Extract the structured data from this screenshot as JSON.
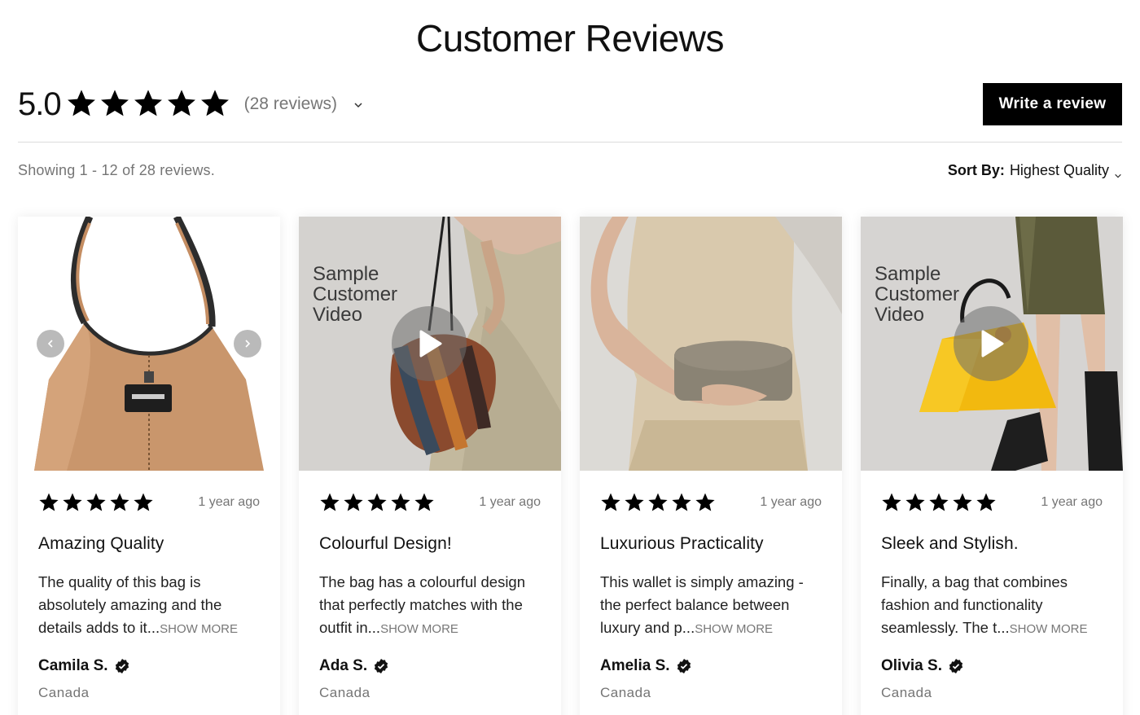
{
  "header": {
    "title": "Customer Reviews"
  },
  "summary": {
    "average": "5.0",
    "stars": 5,
    "count_label": "(28 reviews)",
    "write_review_label": "Write a review"
  },
  "listing": {
    "showing_text": "Showing 1 - 12 of 28 reviews.",
    "sort_label": "Sort By:",
    "sort_value": "Highest Quality"
  },
  "colors": {
    "accent": "#000000",
    "muted_text": "#757575",
    "divider": "#dcdcdc"
  },
  "reviews": [
    {
      "media_type": "image",
      "media_icon": "tan-hobo-bag-photo",
      "rating": 5,
      "time_ago": "1 year ago",
      "title": "Amazing Quality",
      "text": "The quality of this bag is absolutely amazing and the details adds to it...",
      "show_more": "SHOW MORE",
      "author": "Camila S.",
      "country": "Canada"
    },
    {
      "media_type": "video",
      "media_label": "Sample\nCustomer\nVideo",
      "media_icon": "striped-bucket-bag-photo",
      "rating": 5,
      "time_ago": "1 year ago",
      "title": "Colourful Design!",
      "text": "The bag has a colourful design that perfectly matches with the outfit in...",
      "show_more": "SHOW MORE",
      "author": "Ada S.",
      "country": "Canada"
    },
    {
      "media_type": "image",
      "media_icon": "taupe-clutch-photo",
      "rating": 5,
      "time_ago": "1 year ago",
      "title": "Luxurious Practicality",
      "text": "This wallet is simply amazing - the perfect balance between luxury and p...",
      "show_more": "SHOW MORE",
      "author": "Amelia S.",
      "country": "Canada"
    },
    {
      "media_type": "video",
      "media_label": "Sample\nCustomer\nVideo",
      "media_icon": "yellow-shoulder-bag-photo",
      "rating": 5,
      "time_ago": "1 year ago",
      "title": "Sleek and Stylish.",
      "text": "Finally, a bag that combines fashion and functionality seamlessly. The t...",
      "show_more": "SHOW MORE",
      "author": "Olivia S.",
      "country": "Canada"
    }
  ]
}
